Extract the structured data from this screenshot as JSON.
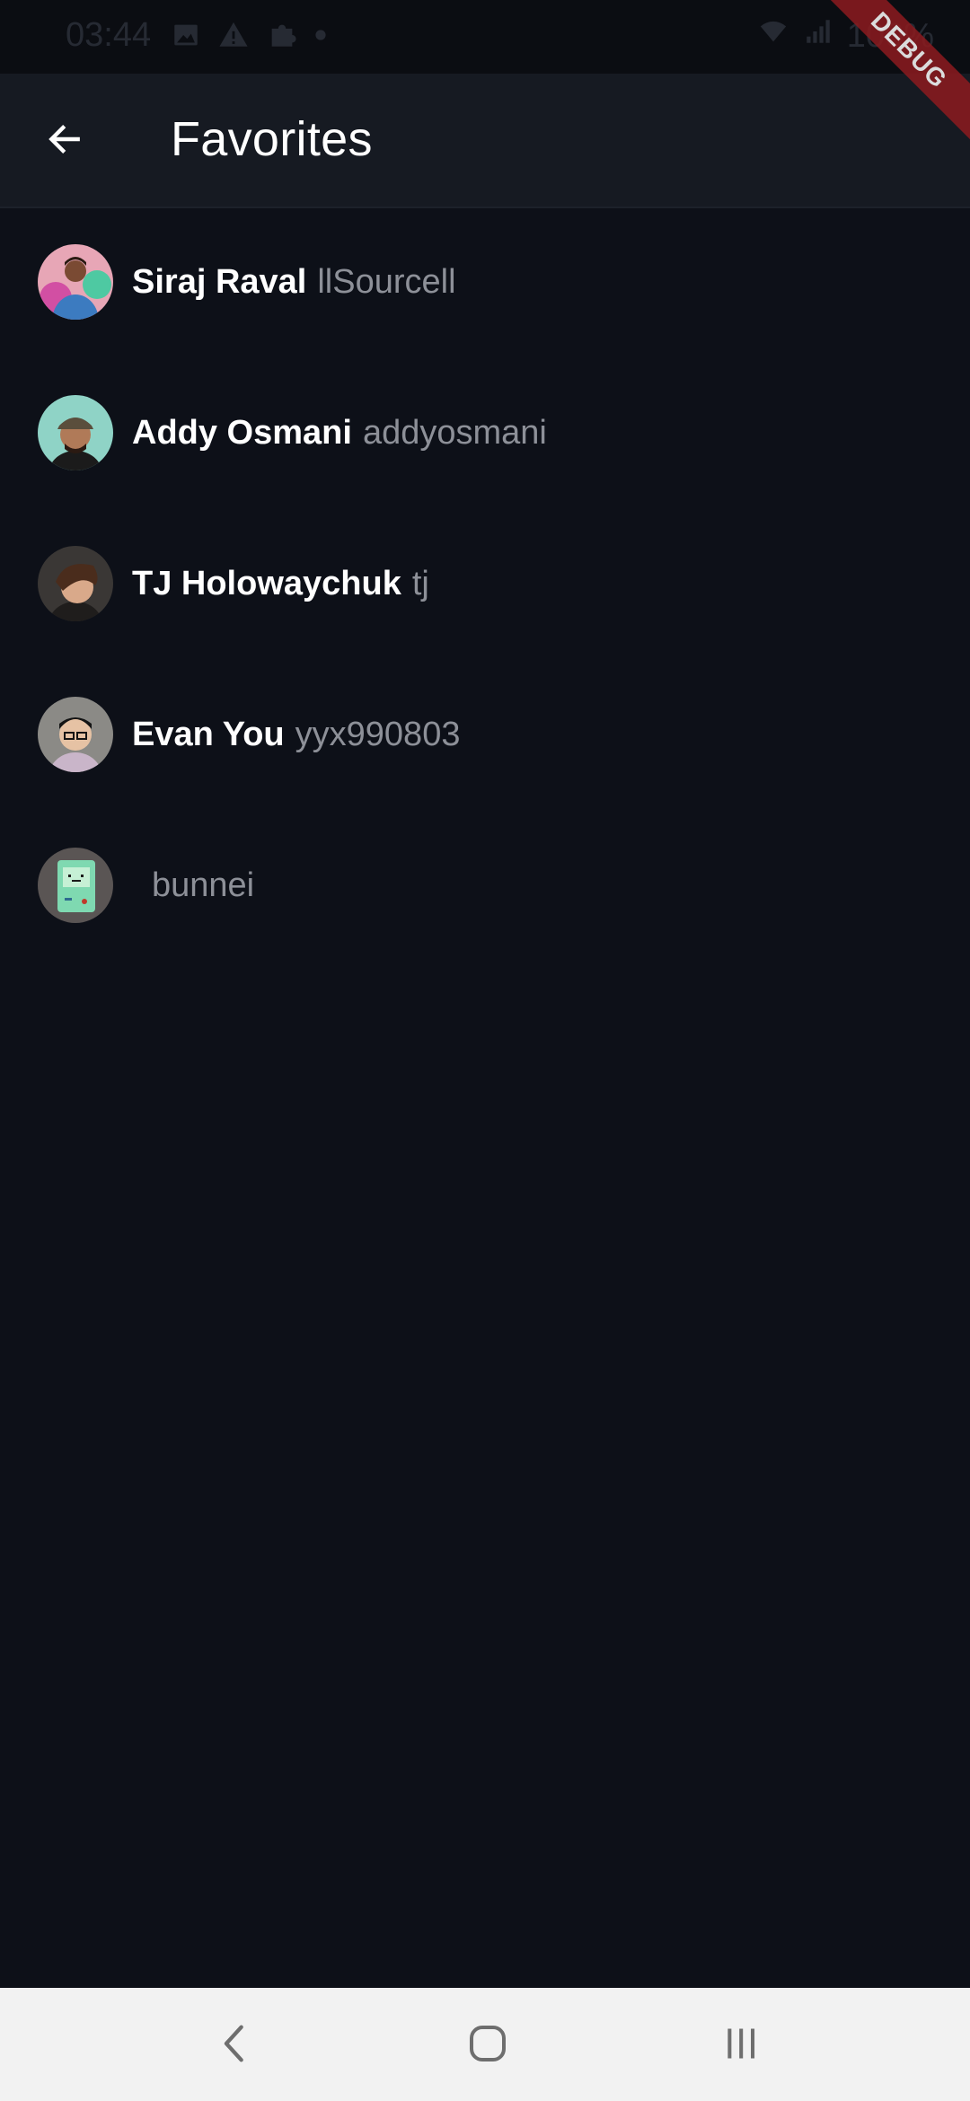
{
  "status_bar": {
    "time": "03:44",
    "battery": "100%",
    "icons": [
      "image-icon",
      "warning-icon",
      "puzzle-icon",
      "dot-icon",
      "wifi-icon",
      "signal-icon"
    ]
  },
  "app_bar": {
    "title": "Favorites",
    "back_icon": "arrow-left-icon"
  },
  "debug_banner": {
    "label": "DEBUG",
    "color": "#8d1b1f"
  },
  "users": [
    {
      "name": "Siraj Raval",
      "handle": "llSourcell"
    },
    {
      "name": "Addy Osmani",
      "handle": "addyosmani"
    },
    {
      "name": "TJ Holowaychuk",
      "handle": "tj"
    },
    {
      "name": "Evan You",
      "handle": "yyx990803"
    },
    {
      "name": "",
      "handle": "bunnei"
    }
  ],
  "nav_bar": {
    "buttons": [
      "back-nav-icon",
      "home-nav-icon",
      "recents-nav-icon"
    ]
  },
  "colors": {
    "background": "#0d1018",
    "app_bar": "#161a22",
    "name_text": "#ffffff",
    "handle_text": "#8d9098"
  }
}
